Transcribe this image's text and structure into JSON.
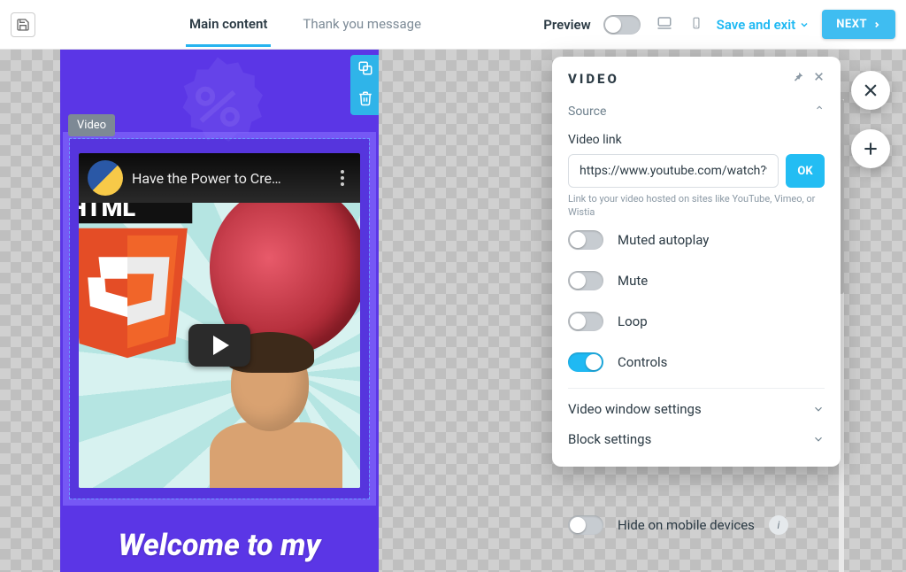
{
  "topbar": {
    "tabs": {
      "main": "Main content",
      "thankyou": "Thank you message"
    },
    "preview_label": "Preview",
    "save_exit": "Save and exit",
    "next": "NEXT"
  },
  "canvas": {
    "element_label": "Video",
    "video_title": "Have the Power to Cre…",
    "welcome": "Welcome to my"
  },
  "panel": {
    "title": "VIDEO",
    "source": {
      "header": "Source",
      "link_label": "Video link",
      "link_value": "https://www.youtube.com/watch?v=T",
      "ok": "OK",
      "hint": "Link to your video hosted on sites like YouTube, Vimeo, or Wistia"
    },
    "toggles": {
      "muted_autoplay": {
        "label": "Muted autoplay",
        "on": false
      },
      "mute": {
        "label": "Mute",
        "on": false
      },
      "loop": {
        "label": "Loop",
        "on": false
      },
      "controls": {
        "label": "Controls",
        "on": true
      }
    },
    "sections": {
      "video_window": "Video window settings",
      "block": "Block settings"
    }
  },
  "hide_mobile": {
    "label": "Hide on mobile devices",
    "on": false
  }
}
